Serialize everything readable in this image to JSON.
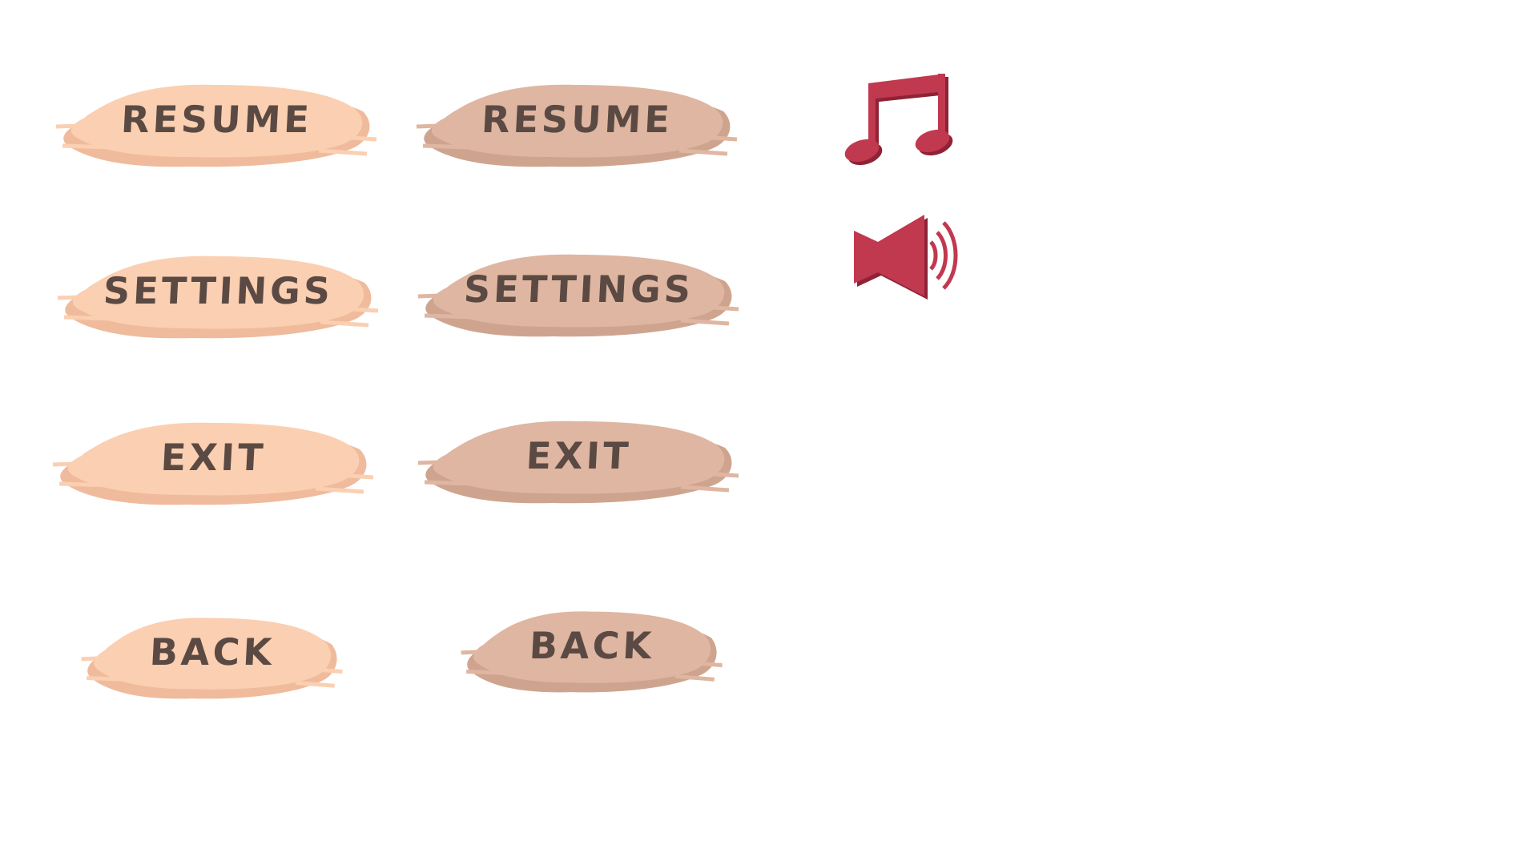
{
  "colors": {
    "normal_fill": "#fbcfb1",
    "normal_shade": "#efbb9c",
    "hover_fill": "#dfb6a1",
    "hover_shade": "#cfa48f",
    "text": "#5a4a43",
    "icon": "#c0394f",
    "icon_shadow": "#8f2236"
  },
  "buttons": {
    "resume_normal": "RESUME",
    "resume_hover": "RESUME",
    "settings_normal": "SETTINGS",
    "settings_hover": "SETTINGS",
    "exit_normal": "EXIT",
    "exit_hover": "EXIT",
    "back_normal": "BACK",
    "back_hover": "BACK"
  },
  "icons": {
    "music": "music-note-icon",
    "sound": "speaker-icon"
  }
}
